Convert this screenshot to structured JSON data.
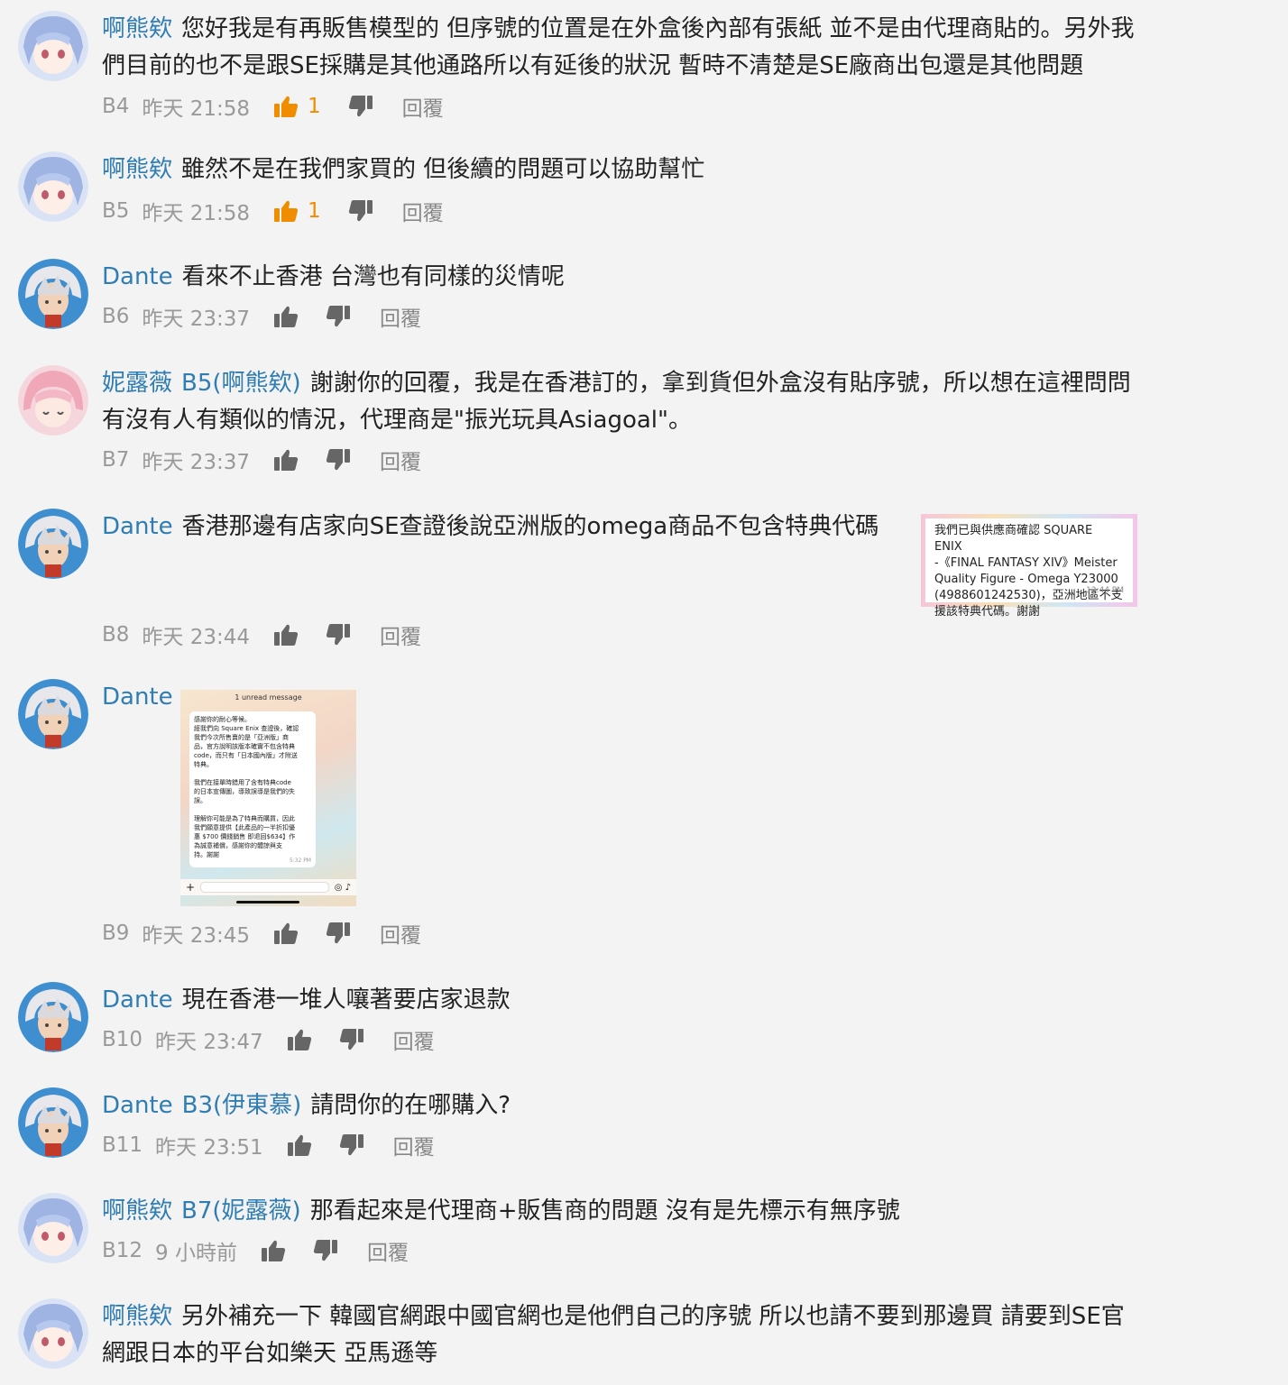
{
  "reply_label": "回覆",
  "comments": [
    {
      "author": "啊熊欸",
      "content_lines": [
        "您好我是有再販售模型的 但序號的位置是在外盒後內部有張紙 並不是由代理商貼的。另外我",
        "們目前的也不是跟SE採購是其他通路所以有延後的狀況 暫時不清楚是SE廠商出包還是其他問題"
      ],
      "floor": "B4",
      "time": "昨天 21:58",
      "likes": "1",
      "avatar": "blue-hair"
    },
    {
      "author": "啊熊欸",
      "content_lines": [
        "雖然不是在我們家買的 但後續的問題可以協助幫忙"
      ],
      "floor": "B5",
      "time": "昨天 21:58",
      "likes": "1",
      "avatar": "blue-hair"
    },
    {
      "author": "Dante",
      "content_lines": [
        "看來不止香港 台灣也有同樣的災情呢"
      ],
      "floor": "B6",
      "time": "昨天 23:37",
      "likes": "",
      "avatar": "silver-hair"
    },
    {
      "author": "妮露薇",
      "reply_to": "B5(啊熊欸)",
      "content_lines": [
        "謝謝你的回覆，我是在香港訂的，拿到貨但外盒沒有貼序號，所以想在這裡問問",
        "有沒有人有類似的情況，代理商是\"振光玩具Asiagoal\"。"
      ],
      "floor": "B7",
      "time": "昨天 23:37",
      "likes": "",
      "avatar": "pink-hair"
    },
    {
      "author": "Dante",
      "content_lines": [
        "香港那邊有店家向SE查證後說亞洲版的omega商品不包含特典代碼"
      ],
      "floor": "B8",
      "time": "昨天 23:44",
      "likes": "",
      "avatar": "silver-hair",
      "attachment_text": [
        "我們已與供應商確認 SQUARE ENIX",
        "-《FINAL FANTASY XIV》Meister",
        "Quality Figure - Omega Y23000",
        "(4988601242530)，亞洲地區不支",
        "援該特典代碼。謝謝"
      ],
      "attachment_time": "12:44 PM"
    },
    {
      "author": "Dante",
      "content_lines": [
        ""
      ],
      "floor": "B9",
      "time": "昨天 23:45",
      "likes": "",
      "avatar": "silver-hair",
      "phone_header": "1 unread message",
      "phone_message": "感謝你的耐心等候。\n經我們向 Square Enix 查證後，確認\n我們今次所售賣的是「亞洲版」商\n品，官方說明該版本確實不包含特典\ncode，而只有「日本國內版」才附送\n特典。\n\n我們在接單時錯用了含有特典code\n的日本宣傳圖，導致誤導是我們的失\n誤。\n\n理解你可能是為了特典而購買，因此\n我們願意提供【此產品的一半折扣優\n惠 $700 價錢銷售 即退回$634】作\n為誠意補償，感謝你的體諒與支\n持。謝謝",
      "phone_time": "5:32 PM"
    },
    {
      "author": "Dante",
      "content_lines": [
        "現在香港一堆人嚷著要店家退款"
      ],
      "floor": "B10",
      "time": "昨天 23:47",
      "likes": "",
      "avatar": "silver-hair"
    },
    {
      "author": "Dante",
      "reply_to": "B3(伊東慕)",
      "content_lines": [
        "請問你的在哪購入?"
      ],
      "floor": "B11",
      "time": "昨天 23:51",
      "likes": "",
      "avatar": "silver-hair"
    },
    {
      "author": "啊熊欸",
      "reply_to": "B7(妮露薇)",
      "content_lines": [
        "那看起來是代理商+販售商的問題 沒有是先標示有無序號"
      ],
      "floor": "B12",
      "time": "9 小時前",
      "likes": "",
      "avatar": "blue-hair"
    },
    {
      "author": "啊熊欸",
      "content_lines": [
        "另外補充一下 韓國官網跟中國官網也是他們自己的序號 所以也請不要到那邊買 請要到SE官",
        "網跟日本的平台如樂天 亞馬遜等"
      ],
      "floor": "",
      "time": "",
      "likes": "",
      "avatar": "blue-hair"
    }
  ],
  "colors": {
    "link": "#2f7db2",
    "like_active": "#f08c00",
    "meta": "#999999",
    "background": "#f3f3f3"
  }
}
